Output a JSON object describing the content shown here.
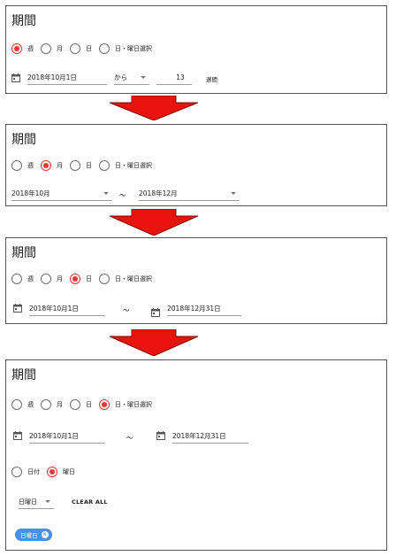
{
  "panel_title": "期間",
  "radio_labels": [
    "週",
    "月",
    "日",
    "日・曜日選択"
  ],
  "colors": {
    "accent": "#e53935",
    "chip": "#4a8ef0",
    "arrow": "#e8130c"
  },
  "icons": {
    "calendar": "calendar-icon",
    "chip_close": "close-icon",
    "arrow": "down-arrow-icon"
  },
  "panel1": {
    "selected": "週",
    "start_date": "2018年10月1日",
    "from_select": "から",
    "weeks_value": "13",
    "weeks_unit": "週間"
  },
  "panel2": {
    "selected": "月",
    "start_month": "2018年10月",
    "tilde": "～",
    "end_month": "2018年12月"
  },
  "panel3": {
    "selected": "日",
    "start_date": "2018年10月1日",
    "tilde": "～",
    "end_date": "2018年12月31日"
  },
  "panel4": {
    "selected": "日・曜日選択",
    "start_date": "2018年10月1日",
    "tilde": "～",
    "end_date": "2018年12月31日",
    "mode_labels": [
      "日付",
      "曜日"
    ],
    "mode_selected": "曜日",
    "weekday_select": "日曜日",
    "clear_all": "CLEAR ALL",
    "chip_label": "日曜日",
    "chip_close": "×"
  }
}
